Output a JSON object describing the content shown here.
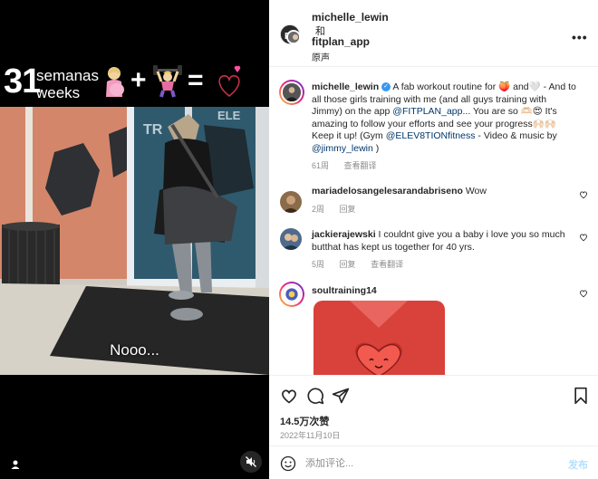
{
  "video": {
    "overlay": {
      "number": "31",
      "line1": "semanas",
      "line2": "weeks",
      "plus": "+",
      "equals": "="
    },
    "subtitle": "Nooo...",
    "icons": [
      "person-icon",
      "mute-icon"
    ]
  },
  "header": {
    "user1": "michelle_lewin",
    "separator": "和",
    "user2": "fitplan_app",
    "audio": "原声",
    "more_icon": "more-icon"
  },
  "caption": {
    "username": "michelle_lewin",
    "verified_icon": "verified-badge-icon",
    "text_1": " A fab workout routine for ",
    "emoji_1": "🍑",
    "text_2": " and",
    "emoji_2": "🤍",
    "text_3": " - And to all those girls training with me (and all guys training with Jimmy) on the app ",
    "mention_1": "@FITPLAN_app",
    "text_4": "... You are so ",
    "emoji_3": "🫶🏻😍",
    "text_5": " It's amazing to follow your efforts and see your progress",
    "emoji_4": "🙌🏻🙌🏻",
    "text_6": " Keep it up! (Gym ",
    "mention_2": "@ELEV8TIONfitness",
    "text_7": " - Video & music by ",
    "mention_3": "@jimmy_lewin",
    "text_8": " )",
    "time": "61周",
    "translate": "查看翻译"
  },
  "comments": [
    {
      "username": "mariadelosangelesarandabriseno",
      "text": " Wow",
      "time": "2周",
      "reply": "回复"
    },
    {
      "username": "jackierajewski",
      "text": " I couldnt give you a baby i love you so much butthat has kept us together for 40 yrs.",
      "time": "5周",
      "reply": "回复",
      "translate": "查看翻译"
    },
    {
      "username": "soultraining14",
      "text": ""
    }
  ],
  "actions": {
    "likes": "14.5万次赞",
    "date": "2022年11月10日",
    "icons": [
      "heart-icon",
      "comment-icon",
      "share-icon",
      "bookmark-icon"
    ]
  },
  "composer": {
    "placeholder": "添加评论...",
    "post": "发布"
  },
  "colors": {
    "accent_link": "#00376b",
    "post_button": "#b2dffc",
    "muted": "#8e8e8e",
    "sticker_red": "#d9413b"
  }
}
